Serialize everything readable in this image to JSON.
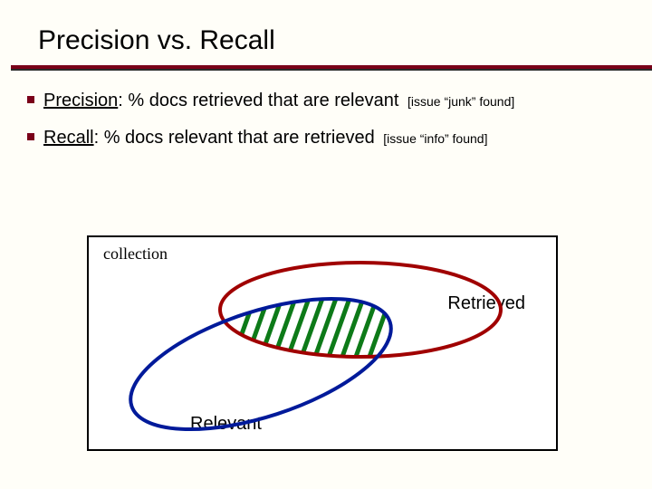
{
  "title": "Precision vs. Recall",
  "bullets": [
    {
      "term": "Precision",
      "rest": ": % docs retrieved that are relevant",
      "issue": "[issue “junk” found]"
    },
    {
      "term": "Recall",
      "rest": ": % docs relevant that are retrieved",
      "issue": "[issue “info” found]"
    }
  ],
  "labels": {
    "collection": "collection",
    "retrieved": "Retrieved",
    "relevant": "Relevant"
  },
  "colors": {
    "accent": "#7a0019",
    "retrieved_ellipse": "#A00000",
    "relevant_ellipse": "#001A9A",
    "hatch": "#0D7A18"
  }
}
